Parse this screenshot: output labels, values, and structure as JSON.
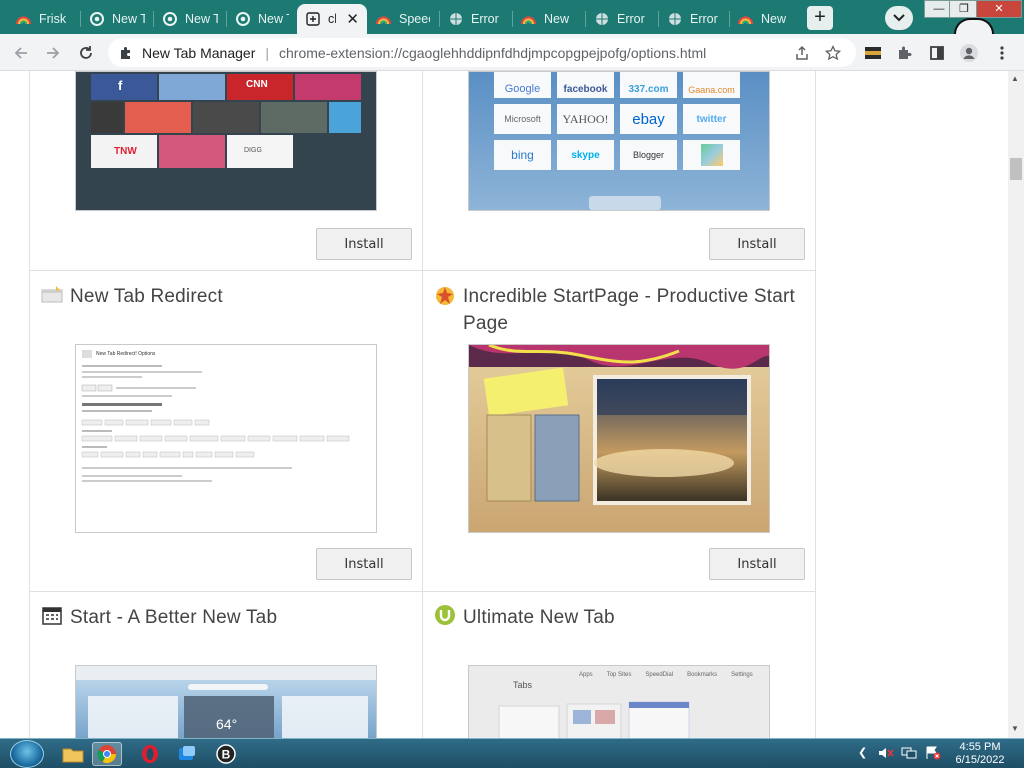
{
  "browser": {
    "tabs": [
      {
        "title": "Frisk",
        "active": false
      },
      {
        "title": "New T",
        "active": false
      },
      {
        "title": "New T",
        "active": false
      },
      {
        "title": "New T",
        "active": false
      },
      {
        "title": "ch",
        "active": true
      },
      {
        "title": "Speec",
        "active": false
      },
      {
        "title": "Error",
        "active": false
      },
      {
        "title": "New",
        "active": false
      },
      {
        "title": "Error",
        "active": false
      },
      {
        "title": "Error",
        "active": false
      },
      {
        "title": "New",
        "active": false
      }
    ],
    "new_tab_symbol": "+",
    "window_controls": {
      "minimize": "—",
      "maximize": "❐",
      "close": "✕"
    },
    "omnibox": {
      "site_name": "New Tab Manager",
      "separator": "|",
      "url": "chrome-extension://cgaoglehhddipnfdhdjmpcopgpejpofg/options.html"
    }
  },
  "page": {
    "cards": [
      {
        "title": "",
        "button": "Install",
        "preview": "tile-grid-dark"
      },
      {
        "title": "",
        "button": "Install",
        "preview": "speed-dial-blue",
        "tiles": [
          "Google",
          "facebook",
          "337.com",
          "Gaana.com",
          "Microsoft",
          "YAHOO!",
          "ebay",
          "twitter",
          "bing",
          "skype",
          "Blogger",
          ""
        ]
      },
      {
        "title": "New Tab Redirect",
        "button": "Install",
        "preview": "options-page",
        "preview_heading": "New Tab Redirect! Options"
      },
      {
        "title": "Incredible StartPage - Productive Start Page",
        "button": "Install",
        "preview": "startpage-collage"
      },
      {
        "title": "Start - A Better New Tab",
        "button": "",
        "preview": "weather-start",
        "preview_temp": "64°"
      },
      {
        "title": "Ultimate New Tab",
        "button": "",
        "preview": "ultimate-tabs",
        "preview_label": "Tabs",
        "preview_menu": [
          "Apps",
          "Top Sites",
          "SpeedDial",
          "Bookmarks",
          "Settings"
        ]
      }
    ]
  },
  "tile_labels_dark": [
    "f",
    "twitter",
    "CNN",
    "Instagram",
    "",
    "",
    "",
    "",
    "",
    "TNW",
    "",
    "DIGG"
  ],
  "taskbar": {
    "clock_time": "4:55 PM",
    "clock_date": "6/15/2022"
  },
  "colors": {
    "tabstrip": "#1c7a73",
    "toolbar": "#f1f3f4",
    "taskbar": "#2f6c88"
  }
}
